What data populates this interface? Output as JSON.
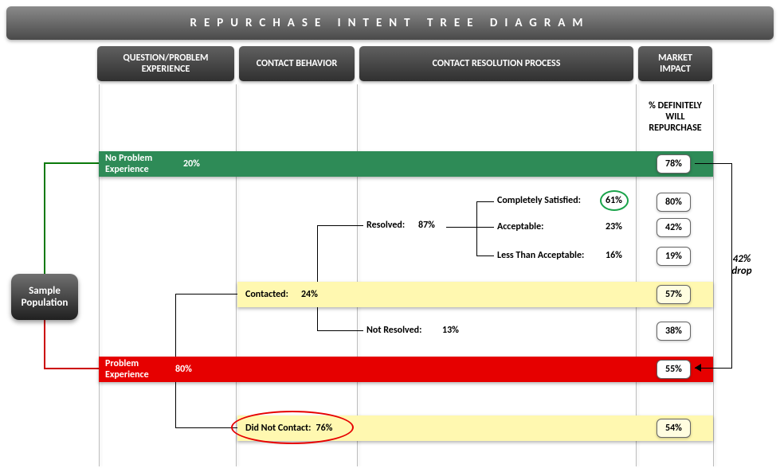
{
  "title": "REPURCHASE INTENT TREE DIAGRAM",
  "headers": {
    "qpe": "QUESTION/PROBLEM EXPERIENCE",
    "cb": "CONTACT BEHAVIOR",
    "crp": "CONTACT RESOLUTION PROCESS",
    "mi": "MARKET IMPACT"
  },
  "sample_population": "Sample Population",
  "subheader_repurchase": "% DEFINITELY WILL REPURCHASE",
  "rows": {
    "no_problem": {
      "label": "No Problem Experience",
      "pct": "20%",
      "badge": "78%"
    },
    "completely_satisfied": {
      "label": "Completely Satisfied:",
      "pct": "61%",
      "badge": "80%"
    },
    "acceptable": {
      "label": "Acceptable:",
      "pct": "23%",
      "badge": "42%"
    },
    "less_than_acceptable": {
      "label": "Less Than Acceptable:",
      "pct": "16%",
      "badge": "19%"
    },
    "resolved": {
      "label": "Resolved:",
      "pct": "87%"
    },
    "contacted": {
      "label": "Contacted:",
      "pct": "24%",
      "badge": "57%"
    },
    "not_resolved": {
      "label": "Not Resolved:",
      "pct": "13%",
      "badge": "38%"
    },
    "problem": {
      "label": "Problem Experience",
      "pct": "80%",
      "badge": "55%"
    },
    "did_not_contact": {
      "label": "Did Not Contact:",
      "pct": "76%",
      "badge": "54%"
    }
  },
  "drop_label": "42% drop"
}
